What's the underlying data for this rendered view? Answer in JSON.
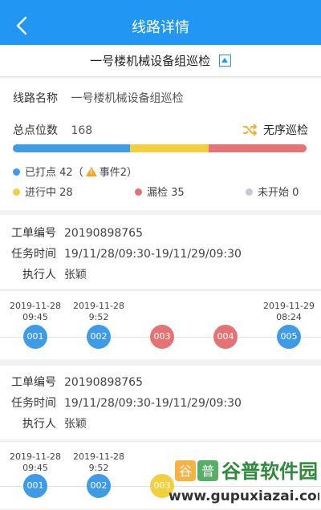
{
  "colors": {
    "primary": "#2196f3",
    "done": "#3d9be9",
    "progress": "#f2cf3d",
    "missed": "#e57373",
    "notstarted": "#c5c9d6"
  },
  "header": {
    "title": "线路详情",
    "back_icon": "chevron-left-icon"
  },
  "route": {
    "name": "一号楼机械设备组巡检"
  },
  "info": {
    "name_label": "线路名称",
    "name_value": "一号楼机械设备组巡检",
    "total_label": "总点位数",
    "total_value": "168",
    "mode_label": "无序巡检"
  },
  "progress": {
    "done": 42,
    "in_progress": 28,
    "missed": 35,
    "not_started": 0
  },
  "legend": {
    "done_label": "已打点 42（",
    "event_label": "事件2）",
    "progress_label": "进行中 28",
    "missed_label": "漏检 35",
    "notstarted_label": "未开始 0"
  },
  "orders": [
    {
      "no_label": "工单编号",
      "no": "20190898765",
      "time_label": "任务时间",
      "time": "19/11/28/09:30-19/11/29/09:30",
      "exec_label": "执行人",
      "exec": "张颖",
      "nodes": [
        {
          "id": "001",
          "status": "done",
          "time_date": "2019-11-28",
          "time_clock": "09:45"
        },
        {
          "id": "002",
          "status": "done",
          "time_date": "2019-11-28",
          "time_clock": "9:52"
        },
        {
          "id": "003",
          "status": "missed",
          "time_date": "",
          "time_clock": ""
        },
        {
          "id": "004",
          "status": "missed",
          "time_date": "",
          "time_clock": ""
        },
        {
          "id": "005",
          "status": "done",
          "time_date": "2019-11-29",
          "time_clock": "08:24"
        }
      ]
    },
    {
      "no_label": "工单编号",
      "no": "20190898765",
      "time_label": "任务时间",
      "time": "19/11/28/09:30-19/11/29/09:30",
      "exec_label": "执行人",
      "exec": "张颖",
      "nodes": [
        {
          "id": "001",
          "status": "done",
          "time_date": "2019-11-28",
          "time_clock": "09:45"
        },
        {
          "id": "002",
          "status": "done",
          "time_date": "2019-11-28",
          "time_clock": "9:52"
        },
        {
          "id": "003",
          "status": "progress",
          "time_date": "",
          "time_clock": ""
        }
      ]
    }
  ],
  "watermark": {
    "brand": "谷普软件园",
    "url": "www.gupuxiazai.com",
    "icon": "logo-watermark"
  }
}
